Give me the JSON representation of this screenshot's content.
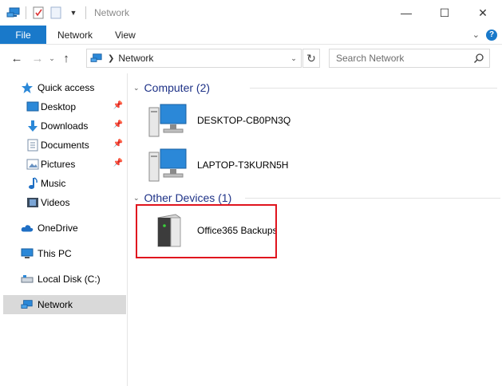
{
  "window": {
    "title": "Network",
    "controls": [
      "minimize",
      "maximize",
      "close"
    ]
  },
  "ribbon": {
    "tabs": [
      {
        "label": "File",
        "active": true
      },
      {
        "label": "Network",
        "active": false
      },
      {
        "label": "View",
        "active": false
      }
    ],
    "help_label": "?"
  },
  "address": {
    "path": "Network",
    "search_placeholder": "Search Network"
  },
  "sidebar": {
    "items": [
      {
        "label": "Quick access",
        "icon": "star-icon",
        "pinned": false,
        "selected": false
      },
      {
        "label": "Desktop",
        "icon": "desktop-icon",
        "pinned": true,
        "selected": false
      },
      {
        "label": "Downloads",
        "icon": "download-arrow-icon",
        "pinned": true,
        "selected": false
      },
      {
        "label": "Documents",
        "icon": "document-icon",
        "pinned": true,
        "selected": false
      },
      {
        "label": "Pictures",
        "icon": "pictures-icon",
        "pinned": true,
        "selected": false
      },
      {
        "label": "Music",
        "icon": "music-note-icon",
        "pinned": false,
        "selected": false
      },
      {
        "label": "Videos",
        "icon": "film-icon",
        "pinned": false,
        "selected": false
      },
      {
        "label": "OneDrive",
        "icon": "cloud-icon",
        "pinned": false,
        "selected": false
      },
      {
        "label": "This PC",
        "icon": "monitor-icon",
        "pinned": false,
        "selected": false
      },
      {
        "label": "Local Disk (C:)",
        "icon": "drive-icon",
        "pinned": false,
        "selected": false
      },
      {
        "label": "Network",
        "icon": "network-icon",
        "pinned": false,
        "selected": true
      }
    ]
  },
  "groups": [
    {
      "title": "Computer (2)",
      "items": [
        {
          "label": "DESKTOP-CB0PN3Q",
          "icon": "computer-icon"
        },
        {
          "label": "LAPTOP-T3KURN5H",
          "icon": "computer-icon"
        }
      ]
    },
    {
      "title": "Other Devices (1)",
      "items": [
        {
          "label": "Office365 Backups",
          "icon": "nas-device-icon",
          "highlighted": true
        }
      ]
    }
  ],
  "colors": {
    "accent": "#1979ca",
    "group_header": "#1e3287",
    "highlight_border": "#e0141e",
    "selected_bg": "#d9d9d9"
  }
}
